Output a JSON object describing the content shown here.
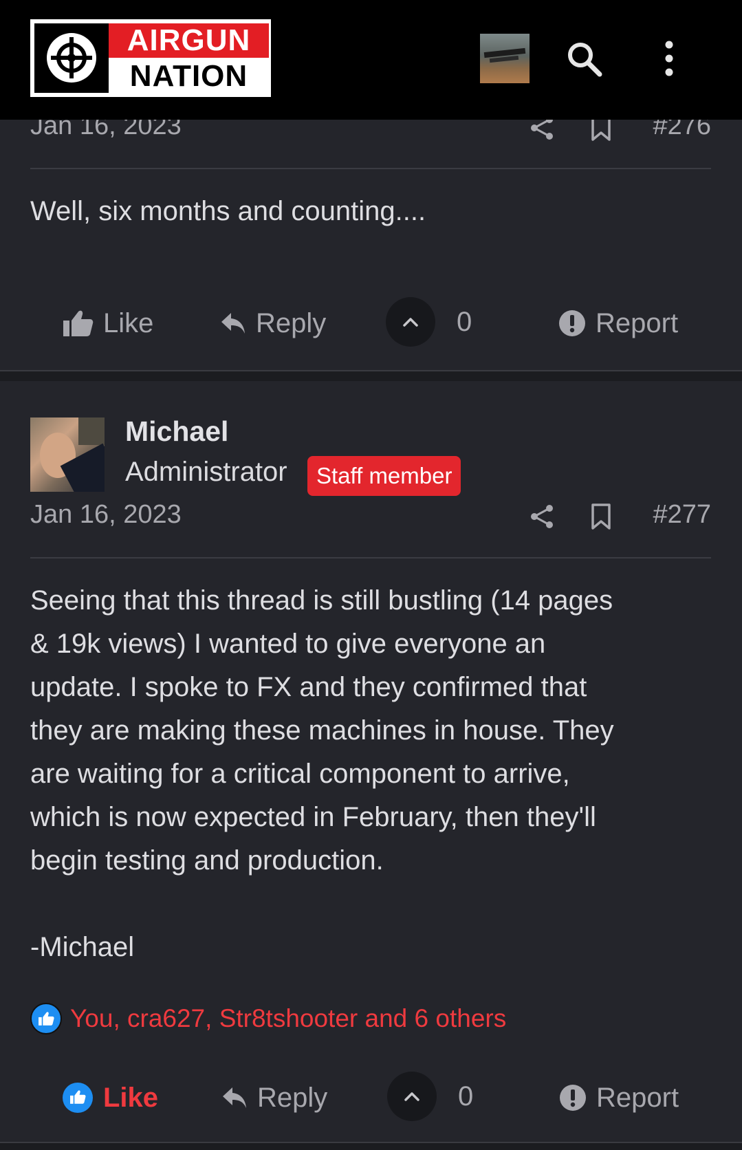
{
  "header": {
    "logo_line1": "AIRGUN",
    "logo_line2": "NATION"
  },
  "post_276": {
    "date": "Jan 16, 2023",
    "number": "#276",
    "body": "Well, six months and counting....",
    "actions": {
      "like": "Like",
      "reply": "Reply",
      "vote_count": "0",
      "report": "Report"
    }
  },
  "post_277": {
    "author": "Michael",
    "role": "Administrator",
    "badge": "Staff member",
    "date": "Jan 16, 2023",
    "number": "#277",
    "body_lines": [
      "Seeing that this thread is still bustling (14 pages",
      "& 19k views) I wanted to give everyone an",
      "update. I spoke to FX and they confirmed that",
      "they are making these machines in house. They",
      "are waiting for a critical component to arrive,",
      "which is now expected in February, then they'll",
      "begin testing and production."
    ],
    "signature": "-Michael",
    "reactions": "You, cra627, Str8tshooter and 6 others",
    "actions": {
      "like": "Like",
      "reply": "Reply",
      "vote_count": "0",
      "report": "Report"
    }
  },
  "colors": {
    "brand_red": "#e31e24",
    "like_blue": "#1d8ef2",
    "background": "#24252b"
  },
  "icons": [
    "target-logo-icon",
    "search-icon",
    "more-vertical-icon",
    "share-icon",
    "bookmark-icon",
    "thumbs-up-icon",
    "reply-icon",
    "chevron-up-icon",
    "report-icon"
  ]
}
